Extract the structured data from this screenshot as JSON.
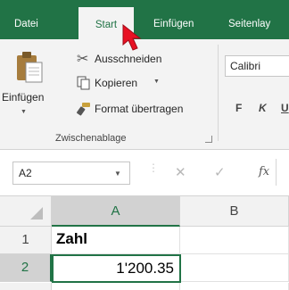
{
  "tabs": [
    {
      "label": "Datei"
    },
    {
      "label": "Start"
    },
    {
      "label": "Einfügen"
    },
    {
      "label": "Seitenlay"
    }
  ],
  "ribbon": {
    "paste_label": "Einfügen",
    "cut_label": "Ausschneiden",
    "copy_label": "Kopieren",
    "format_painter_label": "Format übertragen",
    "group_label": "Zwischenablage",
    "font_name": "Calibri",
    "bold_label": "F",
    "italic_label": "K",
    "underline_label": "U"
  },
  "formula_bar": {
    "name_box": "A2",
    "cancel_symbol": "✕",
    "enter_symbol": "✓",
    "fx_label": "fx"
  },
  "grid": {
    "columns": [
      "A",
      "B"
    ],
    "rows": [
      {
        "number": "1",
        "cells": [
          "Zahl",
          ""
        ]
      },
      {
        "number": "2",
        "cells": [
          "1'200.35",
          ""
        ]
      }
    ]
  },
  "colors": {
    "accent": "#217346",
    "ribbon_bg": "#f3f3f3",
    "cursor": "#e81123"
  },
  "icons": [
    "paste-icon",
    "scissors-icon",
    "copy-icon",
    "format-painter-icon",
    "cursor-pointer-icon",
    "dialog-launcher-icon"
  ]
}
